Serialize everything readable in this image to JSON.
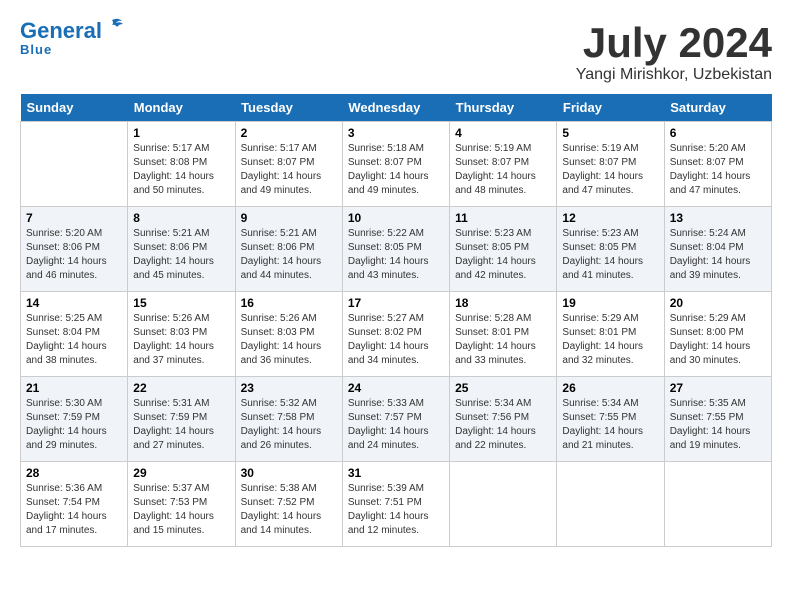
{
  "header": {
    "logo_general": "General",
    "logo_blue": "Blue",
    "month": "July 2024",
    "location": "Yangi Mirishkor, Uzbekistan"
  },
  "weekdays": [
    "Sunday",
    "Monday",
    "Tuesday",
    "Wednesday",
    "Thursday",
    "Friday",
    "Saturday"
  ],
  "weeks": [
    [
      {
        "day": "",
        "sunrise": "",
        "sunset": "",
        "daylight": ""
      },
      {
        "day": "1",
        "sunrise": "Sunrise: 5:17 AM",
        "sunset": "Sunset: 8:08 PM",
        "daylight": "Daylight: 14 hours and 50 minutes."
      },
      {
        "day": "2",
        "sunrise": "Sunrise: 5:17 AM",
        "sunset": "Sunset: 8:07 PM",
        "daylight": "Daylight: 14 hours and 49 minutes."
      },
      {
        "day": "3",
        "sunrise": "Sunrise: 5:18 AM",
        "sunset": "Sunset: 8:07 PM",
        "daylight": "Daylight: 14 hours and 49 minutes."
      },
      {
        "day": "4",
        "sunrise": "Sunrise: 5:19 AM",
        "sunset": "Sunset: 8:07 PM",
        "daylight": "Daylight: 14 hours and 48 minutes."
      },
      {
        "day": "5",
        "sunrise": "Sunrise: 5:19 AM",
        "sunset": "Sunset: 8:07 PM",
        "daylight": "Daylight: 14 hours and 47 minutes."
      },
      {
        "day": "6",
        "sunrise": "Sunrise: 5:20 AM",
        "sunset": "Sunset: 8:07 PM",
        "daylight": "Daylight: 14 hours and 47 minutes."
      }
    ],
    [
      {
        "day": "7",
        "sunrise": "Sunrise: 5:20 AM",
        "sunset": "Sunset: 8:06 PM",
        "daylight": "Daylight: 14 hours and 46 minutes."
      },
      {
        "day": "8",
        "sunrise": "Sunrise: 5:21 AM",
        "sunset": "Sunset: 8:06 PM",
        "daylight": "Daylight: 14 hours and 45 minutes."
      },
      {
        "day": "9",
        "sunrise": "Sunrise: 5:21 AM",
        "sunset": "Sunset: 8:06 PM",
        "daylight": "Daylight: 14 hours and 44 minutes."
      },
      {
        "day": "10",
        "sunrise": "Sunrise: 5:22 AM",
        "sunset": "Sunset: 8:05 PM",
        "daylight": "Daylight: 14 hours and 43 minutes."
      },
      {
        "day": "11",
        "sunrise": "Sunrise: 5:23 AM",
        "sunset": "Sunset: 8:05 PM",
        "daylight": "Daylight: 14 hours and 42 minutes."
      },
      {
        "day": "12",
        "sunrise": "Sunrise: 5:23 AM",
        "sunset": "Sunset: 8:05 PM",
        "daylight": "Daylight: 14 hours and 41 minutes."
      },
      {
        "day": "13",
        "sunrise": "Sunrise: 5:24 AM",
        "sunset": "Sunset: 8:04 PM",
        "daylight": "Daylight: 14 hours and 39 minutes."
      }
    ],
    [
      {
        "day": "14",
        "sunrise": "Sunrise: 5:25 AM",
        "sunset": "Sunset: 8:04 PM",
        "daylight": "Daylight: 14 hours and 38 minutes."
      },
      {
        "day": "15",
        "sunrise": "Sunrise: 5:26 AM",
        "sunset": "Sunset: 8:03 PM",
        "daylight": "Daylight: 14 hours and 37 minutes."
      },
      {
        "day": "16",
        "sunrise": "Sunrise: 5:26 AM",
        "sunset": "Sunset: 8:03 PM",
        "daylight": "Daylight: 14 hours and 36 minutes."
      },
      {
        "day": "17",
        "sunrise": "Sunrise: 5:27 AM",
        "sunset": "Sunset: 8:02 PM",
        "daylight": "Daylight: 14 hours and 34 minutes."
      },
      {
        "day": "18",
        "sunrise": "Sunrise: 5:28 AM",
        "sunset": "Sunset: 8:01 PM",
        "daylight": "Daylight: 14 hours and 33 minutes."
      },
      {
        "day": "19",
        "sunrise": "Sunrise: 5:29 AM",
        "sunset": "Sunset: 8:01 PM",
        "daylight": "Daylight: 14 hours and 32 minutes."
      },
      {
        "day": "20",
        "sunrise": "Sunrise: 5:29 AM",
        "sunset": "Sunset: 8:00 PM",
        "daylight": "Daylight: 14 hours and 30 minutes."
      }
    ],
    [
      {
        "day": "21",
        "sunrise": "Sunrise: 5:30 AM",
        "sunset": "Sunset: 7:59 PM",
        "daylight": "Daylight: 14 hours and 29 minutes."
      },
      {
        "day": "22",
        "sunrise": "Sunrise: 5:31 AM",
        "sunset": "Sunset: 7:59 PM",
        "daylight": "Daylight: 14 hours and 27 minutes."
      },
      {
        "day": "23",
        "sunrise": "Sunrise: 5:32 AM",
        "sunset": "Sunset: 7:58 PM",
        "daylight": "Daylight: 14 hours and 26 minutes."
      },
      {
        "day": "24",
        "sunrise": "Sunrise: 5:33 AM",
        "sunset": "Sunset: 7:57 PM",
        "daylight": "Daylight: 14 hours and 24 minutes."
      },
      {
        "day": "25",
        "sunrise": "Sunrise: 5:34 AM",
        "sunset": "Sunset: 7:56 PM",
        "daylight": "Daylight: 14 hours and 22 minutes."
      },
      {
        "day": "26",
        "sunrise": "Sunrise: 5:34 AM",
        "sunset": "Sunset: 7:55 PM",
        "daylight": "Daylight: 14 hours and 21 minutes."
      },
      {
        "day": "27",
        "sunrise": "Sunrise: 5:35 AM",
        "sunset": "Sunset: 7:55 PM",
        "daylight": "Daylight: 14 hours and 19 minutes."
      }
    ],
    [
      {
        "day": "28",
        "sunrise": "Sunrise: 5:36 AM",
        "sunset": "Sunset: 7:54 PM",
        "daylight": "Daylight: 14 hours and 17 minutes."
      },
      {
        "day": "29",
        "sunrise": "Sunrise: 5:37 AM",
        "sunset": "Sunset: 7:53 PM",
        "daylight": "Daylight: 14 hours and 15 minutes."
      },
      {
        "day": "30",
        "sunrise": "Sunrise: 5:38 AM",
        "sunset": "Sunset: 7:52 PM",
        "daylight": "Daylight: 14 hours and 14 minutes."
      },
      {
        "day": "31",
        "sunrise": "Sunrise: 5:39 AM",
        "sunset": "Sunset: 7:51 PM",
        "daylight": "Daylight: 14 hours and 12 minutes."
      },
      {
        "day": "",
        "sunrise": "",
        "sunset": "",
        "daylight": ""
      },
      {
        "day": "",
        "sunrise": "",
        "sunset": "",
        "daylight": ""
      },
      {
        "day": "",
        "sunrise": "",
        "sunset": "",
        "daylight": ""
      }
    ]
  ]
}
